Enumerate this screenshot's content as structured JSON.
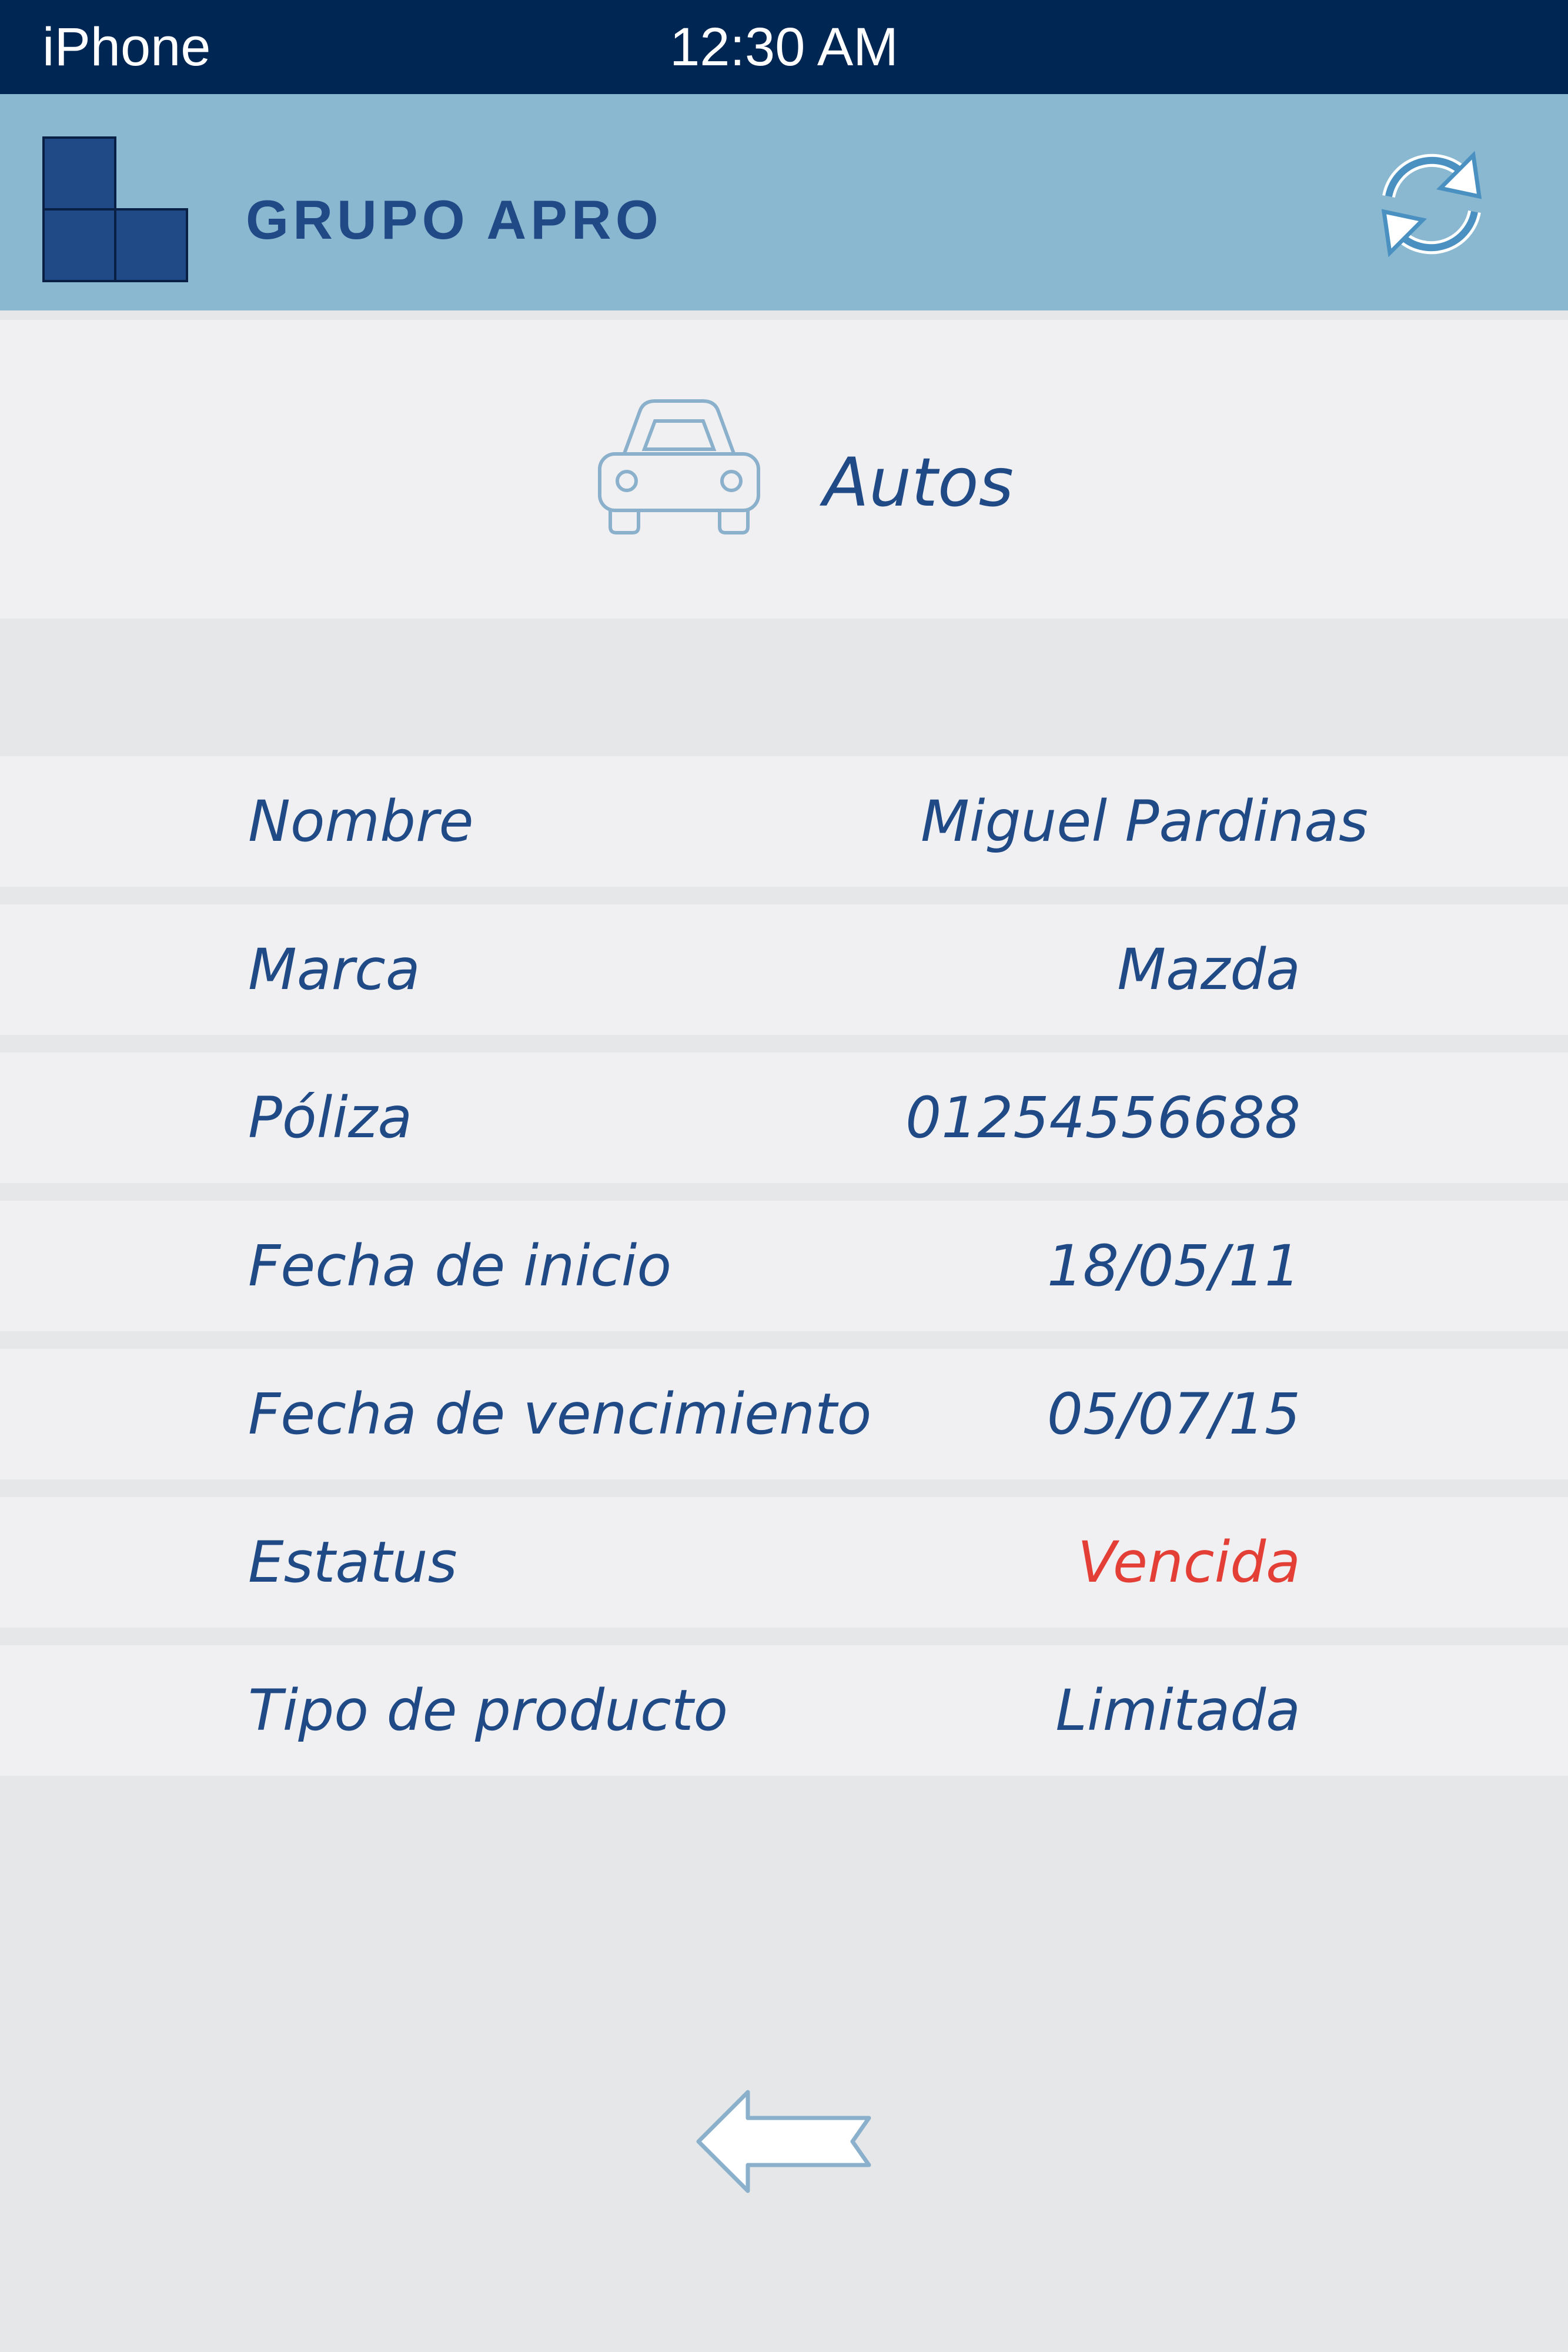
{
  "status_bar": {
    "carrier": "iPhone",
    "time": "12:30 AM"
  },
  "header": {
    "brand": "GRUPO APRO",
    "refresh_icon": "refresh-icon",
    "logo_color": "#1f4a86"
  },
  "category": {
    "label": "Autos",
    "icon": "car-icon"
  },
  "details": [
    {
      "label": "Nombre",
      "value": "Miguel Pardinas"
    },
    {
      "label": "Marca",
      "value": "Mazda"
    },
    {
      "label": "Póliza",
      "value": "01254556688"
    },
    {
      "label": "Fecha de inicio",
      "value": "18/05/11"
    },
    {
      "label": "Fecha de vencimiento",
      "value": "05/07/15"
    },
    {
      "label": "Estatus",
      "value": "Vencida"
    },
    {
      "label": "Tipo de producto",
      "value": "Limitada"
    }
  ],
  "back_icon": "back-arrow-icon",
  "colors": {
    "status_bar": "#002654",
    "header": "#8bb8d1",
    "text": "#1f4a86",
    "alert": "#e43f36"
  }
}
